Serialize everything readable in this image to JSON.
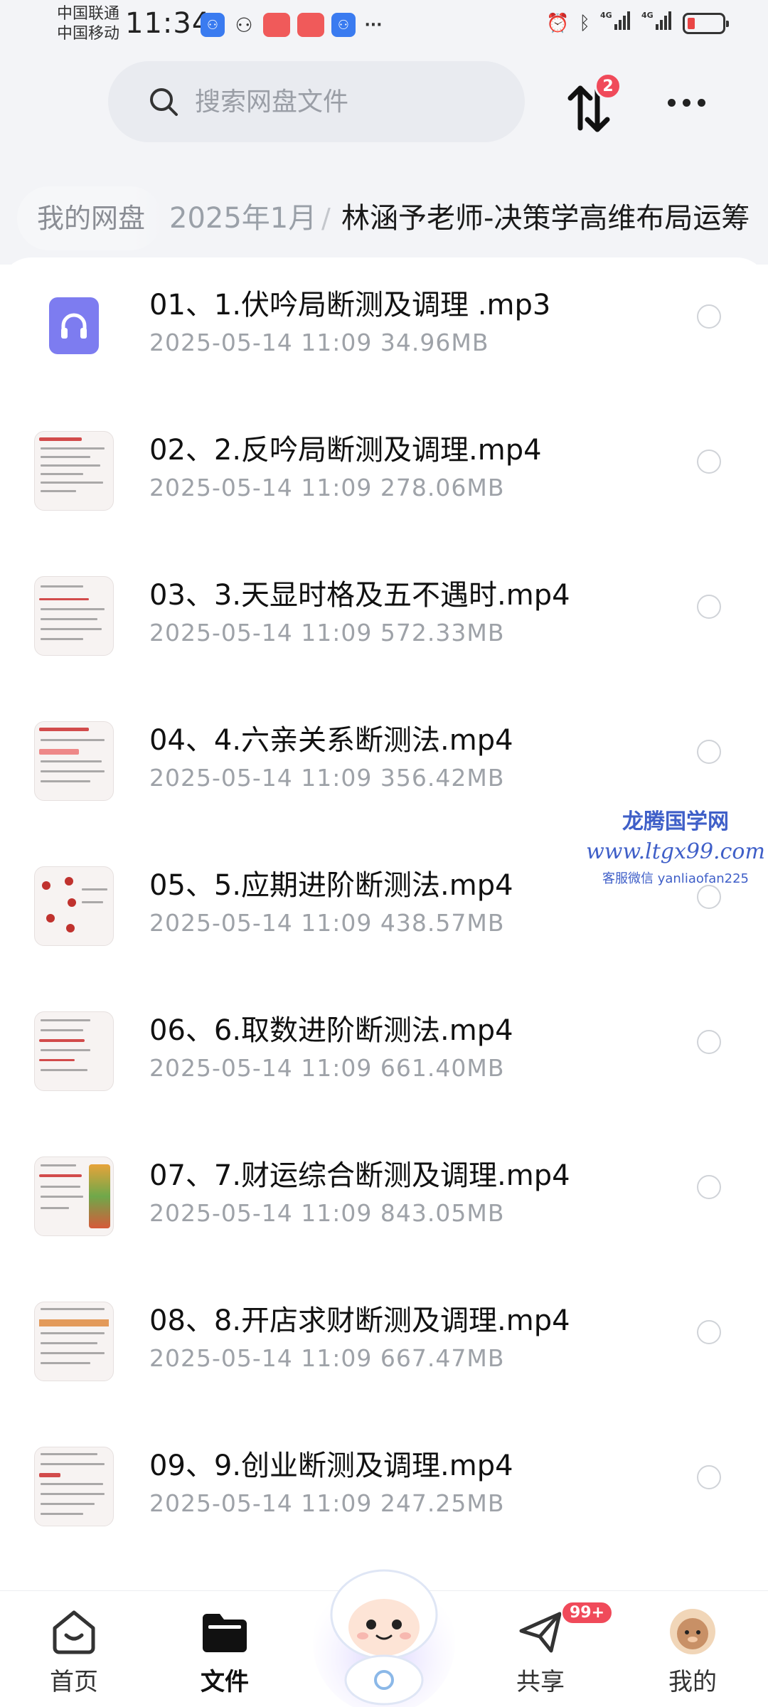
{
  "status_bar": {
    "carrier_1": "中国联通",
    "carrier_2": "中国移动",
    "time": "11:34"
  },
  "search": {
    "placeholder": "搜索网盘文件"
  },
  "transfer": {
    "badge_count": "2"
  },
  "breadcrumb": {
    "root": "我的网盘",
    "middle": "2025年1月",
    "separator": "/",
    "current": "林涵予老师-决策学高维布局运筹"
  },
  "files": [
    {
      "name": "01、1.伏吟局断测及调理 .mp3",
      "date": "2025-05-14  11:09",
      "size": "34.96MB",
      "type": "audio"
    },
    {
      "name": "02、2.反吟局断测及调理.mp4",
      "date": "2025-05-14  11:09",
      "size": "278.06MB",
      "type": "video"
    },
    {
      "name": "03、3.天显时格及五不遇时.mp4",
      "date": "2025-05-14  11:09",
      "size": "572.33MB",
      "type": "video"
    },
    {
      "name": "04、4.六亲关系断测法.mp4",
      "date": "2025-05-14  11:09",
      "size": "356.42MB",
      "type": "video"
    },
    {
      "name": "05、5.应期进阶断测法.mp4",
      "date": "2025-05-14  11:09",
      "size": "438.57MB",
      "type": "video"
    },
    {
      "name": "06、6.取数进阶断测法.mp4",
      "date": "2025-05-14  11:09",
      "size": "661.40MB",
      "type": "video"
    },
    {
      "name": "07、7.财运综合断测及调理.mp4",
      "date": "2025-05-14  11:09",
      "size": "843.05MB",
      "type": "video"
    },
    {
      "name": "08、8.开店求财断测及调理.mp4",
      "date": "2025-05-14  11:09",
      "size": "667.47MB",
      "type": "video"
    },
    {
      "name": "09、9.创业断测及调理.mp4",
      "date": "2025-05-14  11:09",
      "size": "247.25MB",
      "type": "video"
    }
  ],
  "watermark": {
    "line1": "龙腾国学网",
    "line2": "www.ltgx99.com",
    "line3": "客服微信 yanliaofan225"
  },
  "nav": {
    "home": "首页",
    "files": "文件",
    "share": "共享",
    "share_badge": "99+",
    "mine": "我的"
  }
}
